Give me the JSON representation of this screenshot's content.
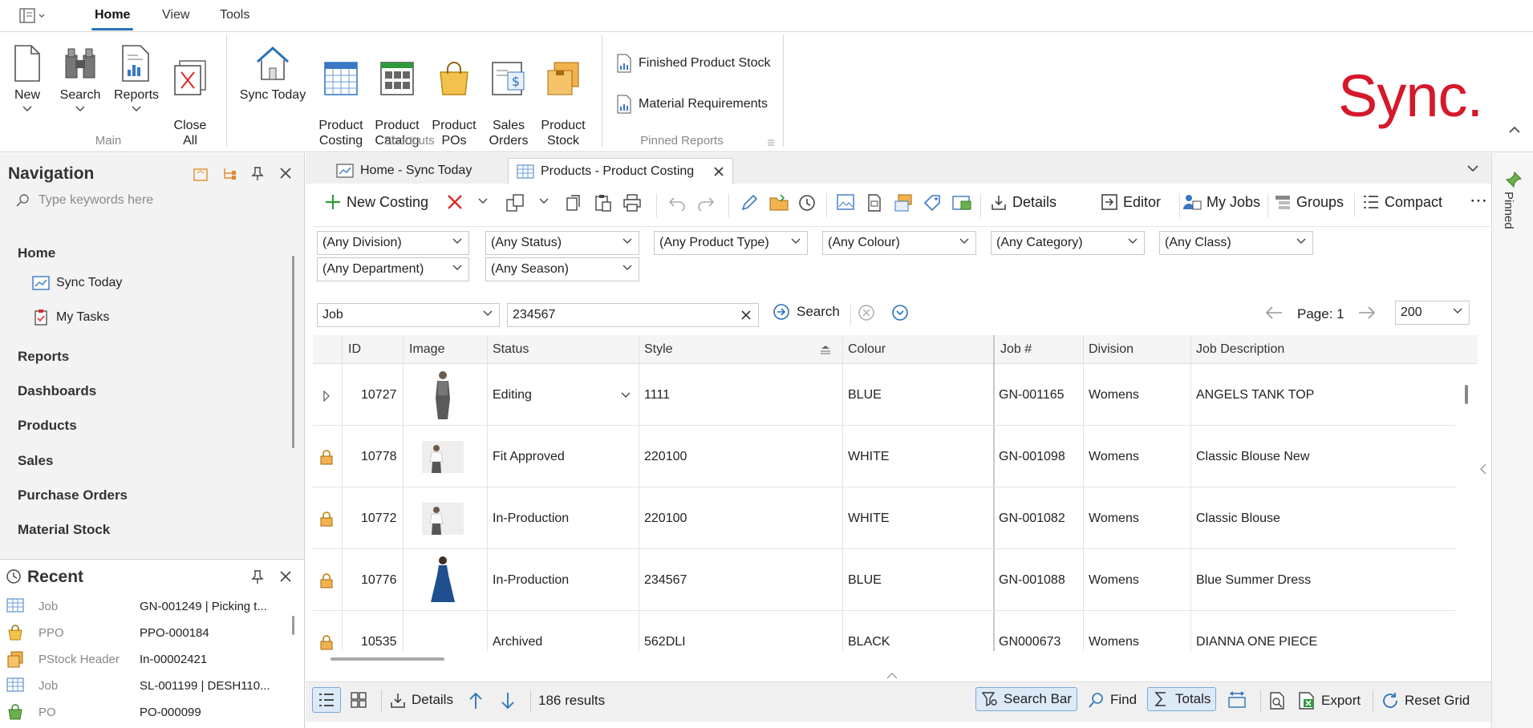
{
  "ribbon_tabs": [
    "Home",
    "View",
    "Tools"
  ],
  "ribbon": {
    "main": {
      "label": "Main",
      "buttons": [
        "New",
        "Search",
        "Reports",
        "Close\nAll"
      ]
    },
    "shortcuts": {
      "label": "Shortcuts",
      "buttons": [
        "Sync Today",
        "Product\nCosting",
        "Product\nCatalog",
        "Product\nPOs",
        "Sales\nOrders",
        "Product\nStock"
      ]
    },
    "pinned_reports": {
      "label": "Pinned Reports",
      "items": [
        "Finished Product Stock",
        "Material Requirements"
      ]
    },
    "logo": "Sync."
  },
  "navigation": {
    "title": "Navigation",
    "search_placeholder": "Type keywords here",
    "sections": [
      "Home",
      "Reports",
      "Dashboards",
      "Products",
      "Sales",
      "Purchase Orders",
      "Material Stock"
    ],
    "home_items": [
      "Sync Today",
      "My Tasks"
    ]
  },
  "recent": {
    "title": "Recent",
    "rows": [
      {
        "type": "Job",
        "value": "GN-001249 | Picking t..."
      },
      {
        "type": "PPO",
        "value": "PPO-000184"
      },
      {
        "type": "PStock Header",
        "value": "In-00002421"
      },
      {
        "type": "Job",
        "value": "SL-001199 | DESH110..."
      },
      {
        "type": "PO",
        "value": "PO-000099"
      }
    ]
  },
  "doc_tabs": [
    "Home - Sync Today",
    "Products - Product Costing"
  ],
  "toolbar": {
    "new_costing": "New Costing",
    "details": "Details",
    "editor": "Editor",
    "my_jobs": "My Jobs",
    "groups": "Groups",
    "compact": "Compact"
  },
  "filters": {
    "division": "(Any Division)",
    "status": "(Any Status)",
    "product_type": "(Any Product Type)",
    "colour": "(Any Colour)",
    "category": "(Any Category)",
    "class": "(Any Class)",
    "department": "(Any Department)",
    "season": "(Any Season)"
  },
  "search": {
    "field": "Job",
    "value": "234567",
    "button": "Search",
    "page_label": "Page: 1",
    "page_size": "200"
  },
  "grid": {
    "columns": [
      "ID",
      "Image",
      "Status",
      "Style",
      "Colour",
      "Job #",
      "Division",
      "Job Description"
    ],
    "rows": [
      {
        "id": "10727",
        "status": "Editing",
        "style": "1111",
        "colour": "BLUE",
        "job": "GN-001165",
        "division": "Womens",
        "desc": "ANGELS TANK TOP",
        "locked": false,
        "image": "tank"
      },
      {
        "id": "10778",
        "status": "Fit Approved",
        "style": "220100",
        "colour": "WHITE",
        "job": "GN-001098",
        "division": "Womens",
        "desc": "Classic Blouse New",
        "locked": true,
        "image": "blouse"
      },
      {
        "id": "10772",
        "status": "In-Production",
        "style": "220100",
        "colour": "WHITE",
        "job": "GN-001082",
        "division": "Womens",
        "desc": "Classic Blouse",
        "locked": true,
        "image": "blouse"
      },
      {
        "id": "10776",
        "status": "In-Production",
        "style": "234567",
        "colour": "BLUE",
        "job": "GN-001088",
        "division": "Womens",
        "desc": "Blue Summer Dress",
        "locked": true,
        "image": "dress"
      },
      {
        "id": "10535",
        "status": "Archived",
        "style": "562DLI",
        "colour": "BLACK",
        "job": "GN000673",
        "division": "Womens",
        "desc": "DIANNA ONE PIECE",
        "locked": true,
        "image": "none"
      }
    ]
  },
  "statusbar": {
    "details": "Details",
    "results": "186 results",
    "search_bar": "Search Bar",
    "find": "Find",
    "totals": "Totals",
    "export": "Export",
    "reset_grid": "Reset Grid"
  },
  "pinned_strip": "Pinned",
  "colors": {
    "accent": "#2b72b9",
    "brand": "#d5182a",
    "delete": "#d92b2b",
    "green": "#2e9a3c"
  }
}
